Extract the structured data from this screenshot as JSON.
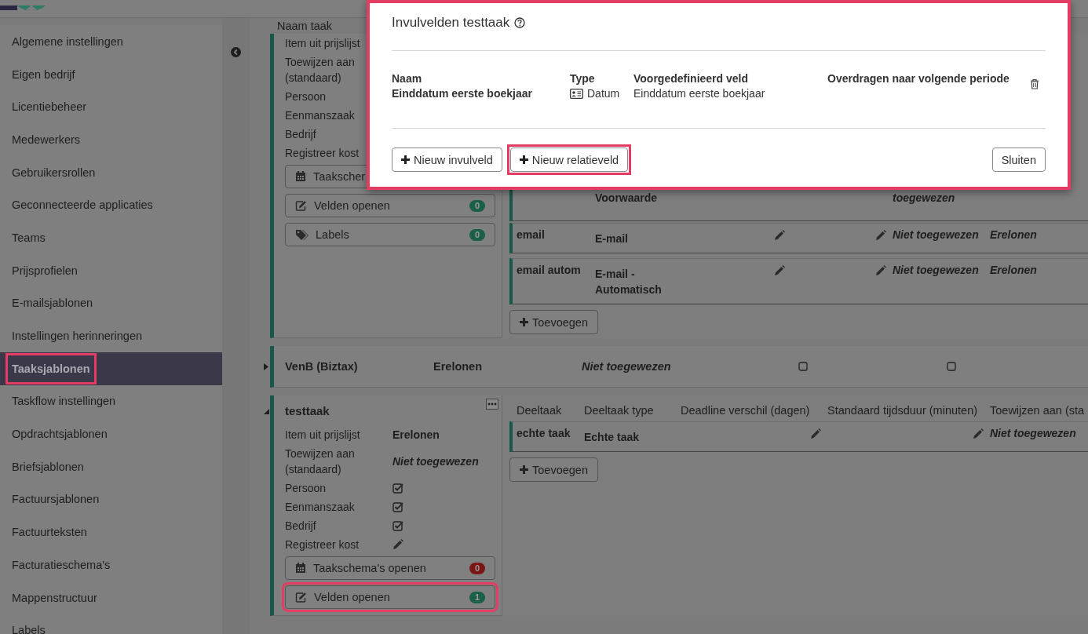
{
  "sidebar": {
    "items": [
      {
        "label": "Algemene instellingen",
        "selected": false,
        "highlighted": false
      },
      {
        "label": "Eigen bedrijf",
        "selected": false,
        "highlighted": false
      },
      {
        "label": "Licentiebeheer",
        "selected": false,
        "highlighted": false
      },
      {
        "label": "Medewerkers",
        "selected": false,
        "highlighted": false
      },
      {
        "label": "Gebruikersrollen",
        "selected": false,
        "highlighted": false
      },
      {
        "label": "Geconnecteerde applicaties",
        "selected": false,
        "highlighted": false
      },
      {
        "label": "Teams",
        "selected": false,
        "highlighted": false
      },
      {
        "label": "Prijsprofielen",
        "selected": false,
        "highlighted": false
      },
      {
        "label": "E-mailsjablonen",
        "selected": false,
        "highlighted": false
      },
      {
        "label": "Instellingen herinneringen",
        "selected": false,
        "highlighted": false
      },
      {
        "label": "Taaksjablonen",
        "selected": true,
        "highlighted": true
      },
      {
        "label": "Taskflow instellingen",
        "selected": false,
        "highlighted": false
      },
      {
        "label": "Opdrachtsjablonen",
        "selected": false,
        "highlighted": false
      },
      {
        "label": "Briefsjablonen",
        "selected": false,
        "highlighted": false
      },
      {
        "label": "Factuursjablonen",
        "selected": false,
        "highlighted": false
      },
      {
        "label": "Factuurteksten",
        "selected": false,
        "highlighted": false
      },
      {
        "label": "Facturatieschema's",
        "selected": false,
        "highlighted": false
      },
      {
        "label": "Mappenstructuur",
        "selected": false,
        "highlighted": false
      },
      {
        "label": "Labels",
        "selected": false,
        "highlighted": false
      }
    ]
  },
  "table_header": {
    "label": "Naam taak"
  },
  "tasks": [
    {
      "kind": "expanded",
      "fields": [
        {
          "label": "Item uit prijslijst",
          "kind": "plain"
        },
        {
          "label": "Toewijzen aan (standaard)",
          "kind": "plain"
        },
        {
          "label": "Persoon",
          "kind": "plain"
        },
        {
          "label": "Eenmanszaak",
          "kind": "plain"
        },
        {
          "label": "Bedrijf",
          "kind": "plain"
        },
        {
          "label": "Registreer kost",
          "kind": "plain"
        }
      ],
      "buttons": [
        {
          "kind": "schedule",
          "label": "Taakscher",
          "highlighted": false
        },
        {
          "kind": "fields",
          "label": "Velden openen",
          "count": "0",
          "color": "#1b5f4b",
          "highlighted": false
        },
        {
          "kind": "labels",
          "label": "Labels",
          "count": "0",
          "color": "#1b5f4b",
          "highlighted": false
        }
      ],
      "subtasks": {
        "rows": [
          {
            "kind": "partial",
            "cells": [
              {
                "kind": "empty"
              },
              {
                "kind": "type",
                "text": "Voorwaarde"
              },
              {
                "kind": "empty"
              },
              {
                "kind": "empty"
              },
              {
                "kind": "empty"
              },
              {
                "kind": "assignee",
                "text": "toegewezen"
              },
              {
                "kind": "empty"
              }
            ]
          },
          {
            "kind": "full",
            "cells": [
              {
                "kind": "name",
                "text": "email"
              },
              {
                "kind": "type",
                "text": "E-mail"
              },
              {
                "kind": "pencil"
              },
              {
                "kind": "empty"
              },
              {
                "kind": "pencil"
              },
              {
                "kind": "assignee",
                "text": "Niet toegewezen"
              },
              {
                "kind": "price",
                "text": "Erelonen"
              }
            ]
          },
          {
            "kind": "full",
            "cells": [
              {
                "kind": "name",
                "text": "email autom"
              },
              {
                "kind": "type",
                "text": "E-mail - Automatisch"
              },
              {
                "kind": "pencil"
              },
              {
                "kind": "empty"
              },
              {
                "kind": "pencil"
              },
              {
                "kind": "assignee",
                "text": "Niet toegewezen"
              },
              {
                "kind": "price",
                "text": "Erelonen"
              }
            ]
          }
        ]
      },
      "add_button": "Toevoegen"
    },
    {
      "kind": "collapsed",
      "name": "VenB (Biztax)",
      "price_item": "Erelonen",
      "assignee": "Niet toegewezen",
      "checks": [
        {
          "checked": false
        },
        {
          "checked": false
        }
      ]
    },
    {
      "kind": "expanded",
      "name": "testtaak",
      "fields": [
        {
          "label": "Item uit prijslijst",
          "kind": "text",
          "value": "Erelonen"
        },
        {
          "label": "Toewijzen aan (standaard)",
          "kind": "assignee",
          "value": "Niet toegewezen"
        },
        {
          "label": "Persoon",
          "kind": "check",
          "checked": true
        },
        {
          "label": "Eenmanszaak",
          "kind": "check",
          "checked": true
        },
        {
          "label": "Bedrijf",
          "kind": "check",
          "checked": true
        },
        {
          "label": "Registreer kost",
          "kind": "pencil"
        }
      ],
      "buttons": [
        {
          "kind": "schedule",
          "label": "Taakschema's openen",
          "count": "0",
          "color": "#7a1616",
          "highlighted": false
        },
        {
          "kind": "fields",
          "label": "Velden openen",
          "count": "1",
          "color": "#1b5f4b",
          "highlighted": true
        }
      ],
      "subtasks": {
        "columns": [
          "Deeltaak",
          "Deeltaak type",
          "Deadline verschil (dagen)",
          "Standaard tijdsduur (minuten)",
          "Toewijzen aan (sta"
        ],
        "rows": [
          {
            "kind": "full",
            "cells": [
              {
                "kind": "name",
                "text": "echte taak"
              },
              {
                "kind": "type",
                "text": "Echte taak"
              },
              {
                "kind": "pencil"
              },
              {
                "kind": "pencil"
              },
              {
                "kind": "assignee",
                "text": "Niet toegewezen"
              }
            ]
          }
        ]
      },
      "add_button": "Toevoegen"
    }
  ],
  "modal": {
    "title": "Invulvelden testtaak",
    "highlighted": true,
    "columns": [
      "Naam",
      "Type",
      "Voorgedefinieerd veld",
      "Overdragen naar volgende periode"
    ],
    "rows": [
      {
        "name": "Einddatum eerste boekjaar",
        "type": "Datum",
        "predefined": "Einddatum eerste boekjaar"
      }
    ],
    "buttons": [
      {
        "kind": "add",
        "label": "Nieuw invulveld",
        "highlighted": false
      },
      {
        "kind": "add",
        "label": "Nieuw relatieveld",
        "highlighted": true
      },
      {
        "kind": "close",
        "label": "Sluiten",
        "highlighted": false
      }
    ]
  }
}
